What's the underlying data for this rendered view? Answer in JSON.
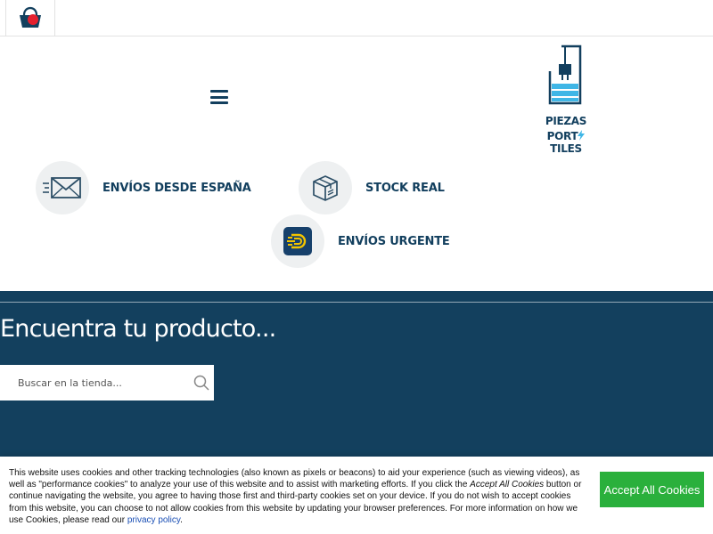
{
  "header": {
    "cart_icon": "shopping-basket-icon",
    "menu_icon": "hamburger-menu-icon"
  },
  "logo": {
    "line1": "PIEZAS",
    "line2_a": "PORT",
    "line2_b": "TILES",
    "colors": {
      "navy": "#123f5e",
      "cyan": "#3fb6e6"
    }
  },
  "features": [
    {
      "icon": "envelope-icon",
      "label": "ENVÍOS DESDE ESPAÑA"
    },
    {
      "icon": "package-box-icon",
      "label": "STOCK REAL"
    },
    {
      "icon": "fast-delivery-icon",
      "label": "ENVÍOS URGENTE"
    }
  ],
  "search": {
    "title": "Encuentra tu producto...",
    "placeholder": "Buscar en la tienda...",
    "button_icon": "search-icon"
  },
  "cookie": {
    "text_1": "This website uses cookies and other tracking technologies (also known as pixels or beacons) to aid your experience (such as viewing videos), as well as \"performance cookies\" to analyze your use of this website and to assist with marketing efforts. If you click the ",
    "text_em": "Accept All Cookies",
    "text_2": " button or continue navigating the website, you agree to having those first and third-party cookies set on your device. If you do not wish to accept cookies from this website, you can choose to not allow cookies from this website by updating your browser preferences. For more information on how we use Cookies, please read our ",
    "link": "privacy policy",
    "text_end": ".",
    "accept_label": "Accept All Cookies"
  },
  "colors": {
    "brand_navy": "#13405e",
    "accept_green": "#2ab03c",
    "cart_red": "#e5202e"
  }
}
